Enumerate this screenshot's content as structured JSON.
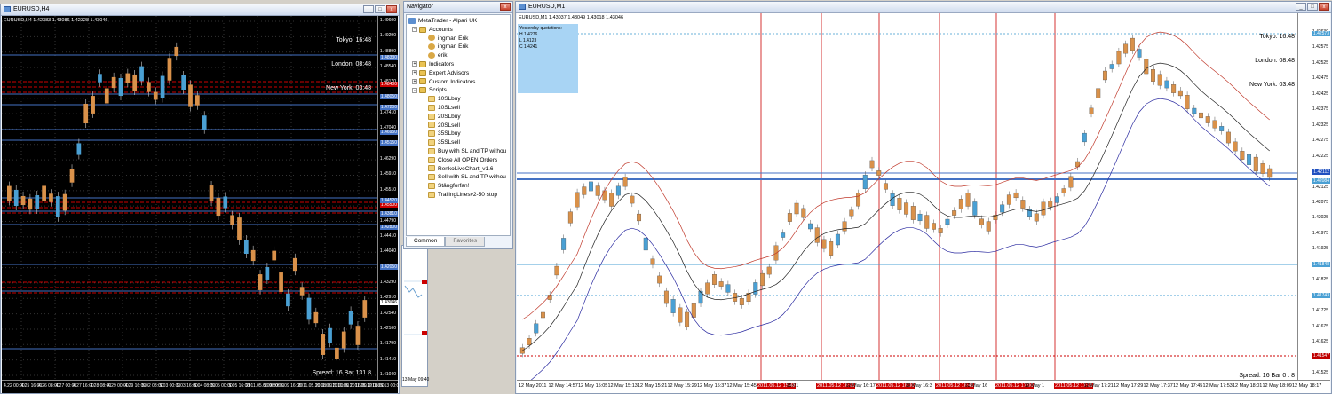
{
  "colors": {
    "h4_bg": "#000000",
    "m1_bg": "#ffffff",
    "bull_up": "#d9914a",
    "bear_down": "#4aa0d4",
    "blue_line": "#4472c4",
    "red_line": "#c00000",
    "quote_box": "#a8d4f4"
  },
  "h4": {
    "title": "EURUSD,H4",
    "ohlc": "EURUSD,H4  1.42383 1.43086 1.42328 1.43046",
    "clock": {
      "tokyo": "Tokyo: 16:48",
      "london": "London: 08:48",
      "newyork": "New York: 03:48"
    },
    "spread": "Spread: 16  Bar  131   8",
    "prices": [
      "1.49600",
      "1.49290",
      "1.48890",
      "1.48540",
      "1.48170",
      "1.47790",
      "1.47410",
      "1.47040",
      "1.46660",
      "1.46290",
      "1.45910",
      "1.45510",
      "1.45160",
      "1.44790",
      "1.44410",
      "1.44040",
      "1.43660",
      "1.43290",
      "1.42910",
      "1.42540",
      "1.42160",
      "1.41790",
      "1.41410",
      "1.41040"
    ],
    "red_boxes": [
      "1.48400",
      "1.45500"
    ],
    "blue_boxes": [
      "1.48330",
      "1.48050",
      "1.47200",
      "1.46950",
      "1.45150",
      "1.44520",
      "1.43810",
      "1.42800",
      "1.42050"
    ],
    "current": "1.43046",
    "times": [
      "4.22 00:00",
      "4.25 16:00",
      "4.26 08:00",
      "4.27 00:00",
      "4.27 16:00",
      "4.28 08:00",
      "4.29 00:00",
      "4.29 16:00",
      "5.02 08:00",
      "5.03 00:00",
      "5.03 16:00",
      "5.04 08:00",
      "5.05 00:00",
      "5.05 16:00",
      "2011.05.06 08:00",
      "5.09 00:00",
      "5.09 16:00",
      "2011.05.10 08:00",
      "2011.05.11 00:00",
      "2011.05.11 16:00",
      "2011.05.12 08:00",
      "2011.05.13 00:00"
    ]
  },
  "navigator": {
    "title": "Navigator",
    "root": "MetaTrader - Alpari UK",
    "accounts": "Accounts",
    "account_items": [
      "ingman Erik",
      "ingman Erik",
      "erik"
    ],
    "indicators": "Indicators",
    "experts": "Expert Advisors",
    "custom": "Custom Indicators",
    "scripts": "Scripts",
    "script_items": [
      "10SLbuy",
      "10SLsell",
      "20SLbuy",
      "20SLsell",
      "35SLbuy",
      "35SLsell",
      "Buy with SL and TP withou",
      "Close All OPEN Orders",
      "RenkoLiveChart_v1.6",
      "Sell with SL and TP withou",
      "Stängforfan!",
      "TrailingLinesv2-50 stop"
    ],
    "tabs": [
      "Common",
      "Favorites"
    ]
  },
  "small": {
    "time_label": "13 May 09:40"
  },
  "m1": {
    "title": "EURUSD,M1",
    "ohlc": "EURUSD,M1  1.43037 1.43049 1.43018 1.43046",
    "quotes": {
      "title": "Yesterday quotations:",
      "h": "H 1.4276",
      "l": "L 1.4123",
      "c": "C 1.4241"
    },
    "clock": {
      "tokyo": "Tokyo: 16:48",
      "london": "London: 08:48",
      "newyork": "New York: 03:48"
    },
    "spread": "Spread: 16    Bar  0 . 8",
    "prices": [
      "1.42630",
      "1.42575",
      "1.42525",
      "1.42475",
      "1.42425",
      "1.42375",
      "1.42325",
      "1.42275",
      "1.42225",
      "1.42175",
      "1.42125",
      "1.42075",
      "1.42025",
      "1.41975",
      "1.41925",
      "1.41875",
      "1.41825",
      "1.41775",
      "1.41725",
      "1.41675",
      "1.41625",
      "1.41575",
      "1.41525"
    ],
    "boxes": [
      {
        "v": "1.42112",
        "c": "#2050c0"
      },
      {
        "v": "1.42084",
        "c": "#4aa0d4"
      },
      {
        "v": "1.41848",
        "c": "#4aa0d4"
      },
      {
        "v": "1.41743",
        "c": "#4aa0d4"
      },
      {
        "v": "1.41547",
        "c": "#c00000"
      },
      {
        "v": "1.42573",
        "c": "#4aa0d4"
      }
    ],
    "times": [
      {
        "t": "12 May 2011",
        "red": false
      },
      {
        "t": "12 May 14:57",
        "red": false
      },
      {
        "t": "12 May 15:05",
        "red": false
      },
      {
        "t": "12 May 15:13",
        "red": false
      },
      {
        "t": "12 May 15:21",
        "red": false
      },
      {
        "t": "12 May 15:29",
        "red": false
      },
      {
        "t": "12 May 15:37",
        "red": false
      },
      {
        "t": "12 May 15:45",
        "red": false
      },
      {
        "t": "2011.05.12 15:48",
        "red": true
      },
      {
        "t": "16:01",
        "red": false
      },
      {
        "t": "2011.05.12 16:15",
        "red": true
      },
      {
        "t": "12 May 16:17",
        "red": false
      },
      {
        "t": "2011.05.12 16:30",
        "red": true
      },
      {
        "t": "12 May 16:3",
        "red": false
      },
      {
        "t": "2011.05.12 16:45",
        "red": true
      },
      {
        "t": "12 May 16",
        "red": false
      },
      {
        "t": "2011.05.12 17:00",
        "red": true
      },
      {
        "t": "12 May 1",
        "red": false
      },
      {
        "t": "2011.05.12 17:15",
        "red": true
      },
      {
        "t": "12 May 17:21",
        "red": false
      },
      {
        "t": "12 May 17:29",
        "red": false
      },
      {
        "t": "12 May 17:37",
        "red": false
      },
      {
        "t": "12 May 17:45",
        "red": false
      },
      {
        "t": "12 May 17:53",
        "red": false
      },
      {
        "t": "12 May 18:01",
        "red": false
      },
      {
        "t": "12 May 18:09",
        "red": false
      },
      {
        "t": "12 May 18:17",
        "red": false
      }
    ]
  }
}
